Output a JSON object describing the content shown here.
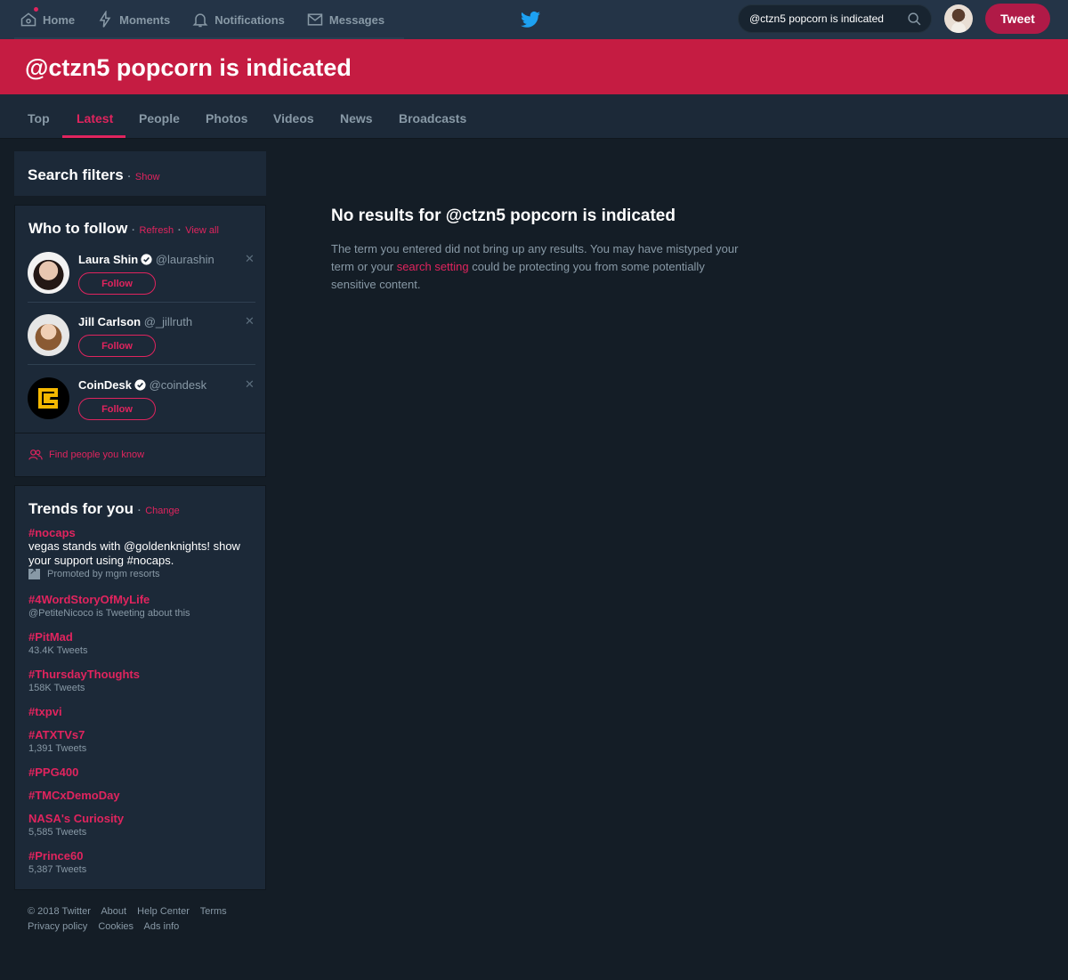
{
  "nav": {
    "home": "Home",
    "moments": "Moments",
    "notifications": "Notifications",
    "messages": "Messages",
    "search_value": "@ctzn5 popcorn is indicated",
    "tweet_label": "Tweet"
  },
  "banner": {
    "title": "@ctzn5 popcorn is indicated"
  },
  "tabs": [
    "Top",
    "Latest",
    "People",
    "Photos",
    "Videos",
    "News",
    "Broadcasts"
  ],
  "filters": {
    "title": "Search filters",
    "show": "Show"
  },
  "who_to_follow": {
    "title": "Who to follow",
    "refresh": "Refresh",
    "view_all": "View all",
    "follow_label": "Follow",
    "users": [
      {
        "name": "Laura Shin",
        "handle": "@laurashin",
        "verified": true
      },
      {
        "name": "Jill Carlson",
        "handle": "@_jillruth",
        "verified": false
      },
      {
        "name": "CoinDesk",
        "handle": "@coindesk",
        "verified": true
      }
    ],
    "find_people": "Find people you know"
  },
  "trends": {
    "title": "Trends for you",
    "change": "Change",
    "items": [
      {
        "name": "#nocaps",
        "desc": "vegas stands with @goldenknights! show your support using #nocaps.",
        "promo": "Promoted by mgm resorts"
      },
      {
        "name": "#4WordStoryOfMyLife",
        "meta": "@PetiteNicoco is Tweeting about this"
      },
      {
        "name": "#PitMad",
        "meta": "43.4K Tweets"
      },
      {
        "name": "#ThursdayThoughts",
        "meta": "158K Tweets"
      },
      {
        "name": "#txpvi"
      },
      {
        "name": "#ATXTVs7",
        "meta": "1,391 Tweets"
      },
      {
        "name": "#PPG400"
      },
      {
        "name": "#TMCxDemoDay"
      },
      {
        "name": "NASA's Curiosity",
        "meta": "5,585 Tweets"
      },
      {
        "name": "#Prince60",
        "meta": "5,387 Tweets"
      }
    ]
  },
  "footer": {
    "line1": [
      "© 2018 Twitter",
      "About",
      "Help Center",
      "Terms"
    ],
    "line2": [
      "Privacy policy",
      "Cookies",
      "Ads info"
    ]
  },
  "main": {
    "heading": "No results for @ctzn5 popcorn is indicated",
    "text_before": "The term you entered did not bring up any results. You may have mistyped your term or your ",
    "link": "search setting",
    "text_after": " could be protecting you from some potentially sensitive content."
  },
  "colors": {
    "accent": "#e0245e",
    "banner": "#c51c42",
    "background": "#141d26",
    "panel": "#1c2938"
  }
}
